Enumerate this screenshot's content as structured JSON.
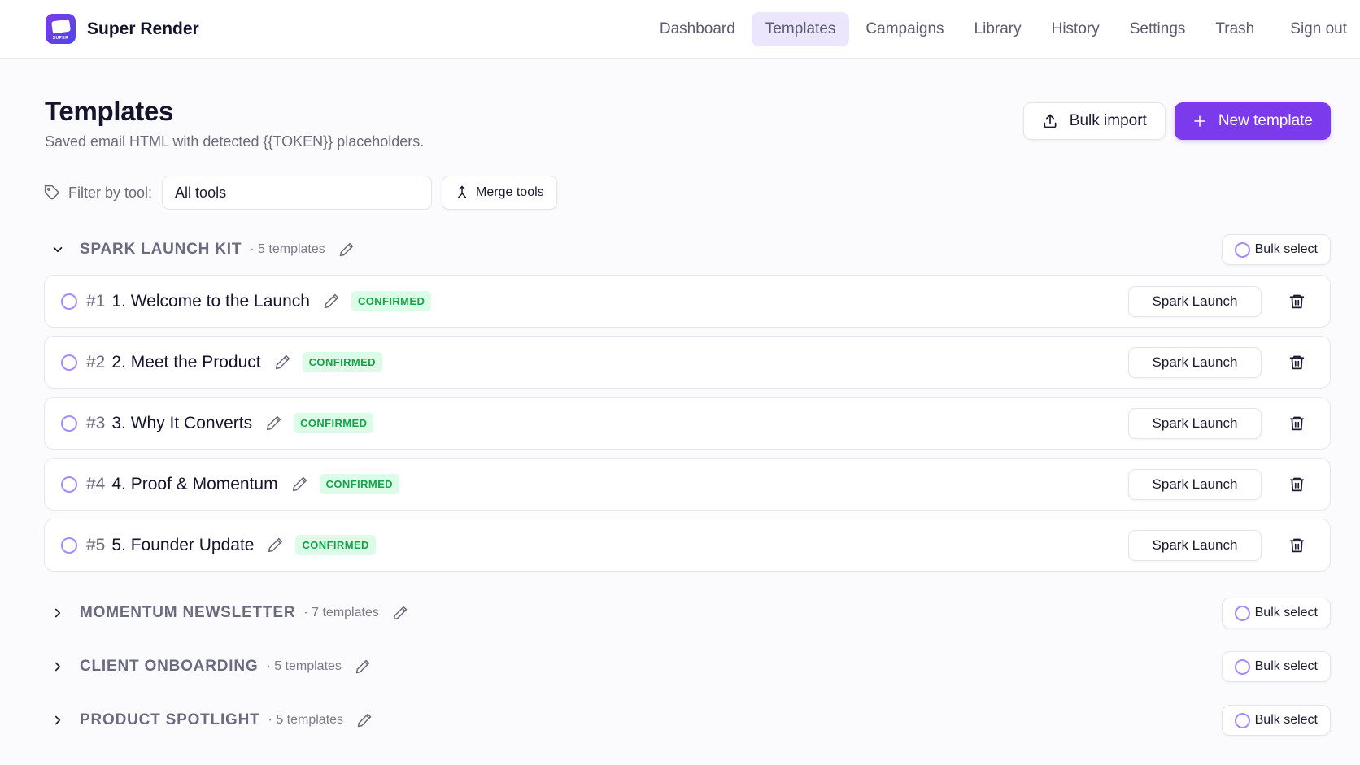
{
  "app": {
    "name": "Super Render",
    "logo_text": "SUPER"
  },
  "nav": {
    "items": [
      "Dashboard",
      "Templates",
      "Campaigns",
      "Library",
      "History",
      "Settings",
      "Trash"
    ],
    "active": "Templates",
    "signout": "Sign out"
  },
  "page": {
    "title": "Templates",
    "subtitle": "Saved email HTML with detected {{TOKEN}} placeholders.",
    "bulk_import": "Bulk import",
    "new_template": "New template"
  },
  "filter": {
    "label": "Filter by tool:",
    "value": "All tools",
    "merge": "Merge tools"
  },
  "groups": [
    {
      "name": "SPARK LAUNCH KIT",
      "count": "· 5 templates",
      "bulk": "Bulk select",
      "expanded": true,
      "rows": [
        {
          "num": "#1",
          "title": "1. Welcome to the Launch",
          "status": "CONFIRMED",
          "tool": "Spark Launch"
        },
        {
          "num": "#2",
          "title": "2. Meet the Product",
          "status": "CONFIRMED",
          "tool": "Spark Launch"
        },
        {
          "num": "#3",
          "title": "3. Why It Converts",
          "status": "CONFIRMED",
          "tool": "Spark Launch"
        },
        {
          "num": "#4",
          "title": "4. Proof & Momentum",
          "status": "CONFIRMED",
          "tool": "Spark Launch"
        },
        {
          "num": "#5",
          "title": "5. Founder Update",
          "status": "CONFIRMED",
          "tool": "Spark Launch"
        }
      ]
    },
    {
      "name": "MOMENTUM NEWSLETTER",
      "count": "· 7 templates",
      "bulk": "Bulk select",
      "expanded": false
    },
    {
      "name": "CLIENT ONBOARDING",
      "count": "· 5 templates",
      "bulk": "Bulk select",
      "expanded": false
    },
    {
      "name": "PRODUCT SPOTLIGHT",
      "count": "· 5 templates",
      "bulk": "Bulk select",
      "expanded": false
    }
  ],
  "colors": {
    "accent": "#7c3aed",
    "nav_active_bg": "#ece6fd",
    "badge_bg": "#dcfce7",
    "badge_text": "#16a34a"
  },
  "icons": {
    "upload": "upload-icon",
    "plus": "plus-icon",
    "tag": "tag-icon",
    "merge": "merge-icon",
    "chevron_down": "chevron-down-icon",
    "chevron_right": "chevron-right-icon",
    "pencil": "pencil-icon",
    "trash": "trash-icon"
  }
}
